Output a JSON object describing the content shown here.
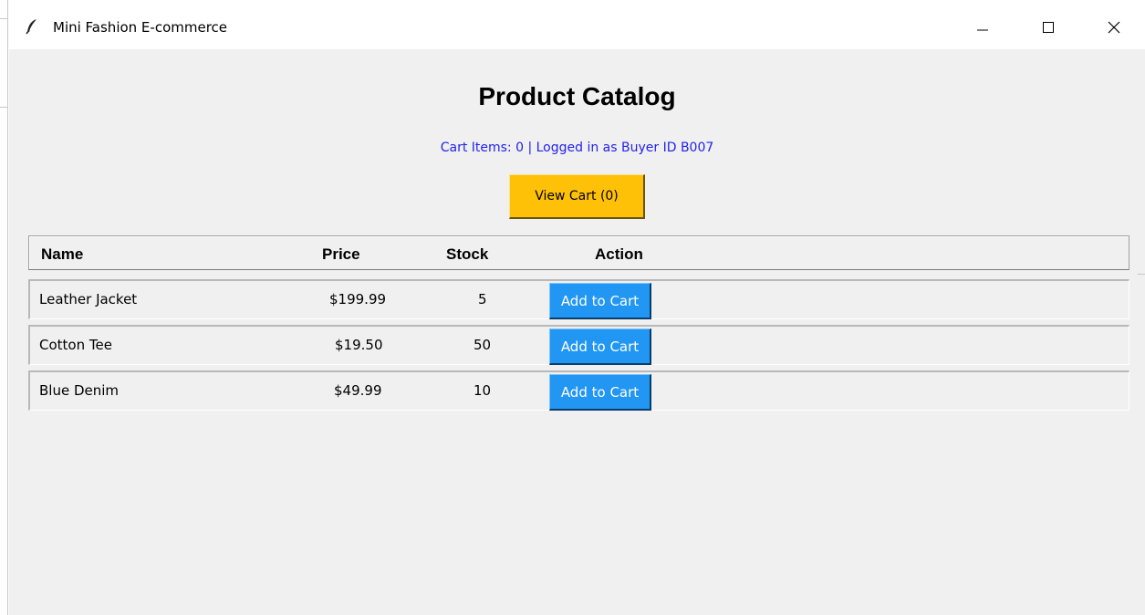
{
  "window": {
    "title": "Mini Fashion E-commerce"
  },
  "header": {
    "title": "Product Catalog",
    "status": "Cart Items: 0 | Logged in as Buyer ID B007",
    "view_cart_label": "View Cart (0)"
  },
  "colors": {
    "status_text": "#2222ee",
    "view_cart_bg": "#ffc107",
    "add_button_bg": "#2196f3",
    "window_bg": "#f0f0f0"
  },
  "table": {
    "columns": [
      "Name",
      "Price",
      "Stock",
      "Action"
    ],
    "rows": [
      {
        "name": "Leather Jacket",
        "price": "$199.99",
        "stock": "5",
        "action": "Add to Cart"
      },
      {
        "name": "Cotton Tee",
        "price": "$19.50",
        "stock": "50",
        "action": "Add to Cart"
      },
      {
        "name": "Blue Denim",
        "price": "$49.99",
        "stock": "10",
        "action": "Add to Cart"
      }
    ]
  }
}
